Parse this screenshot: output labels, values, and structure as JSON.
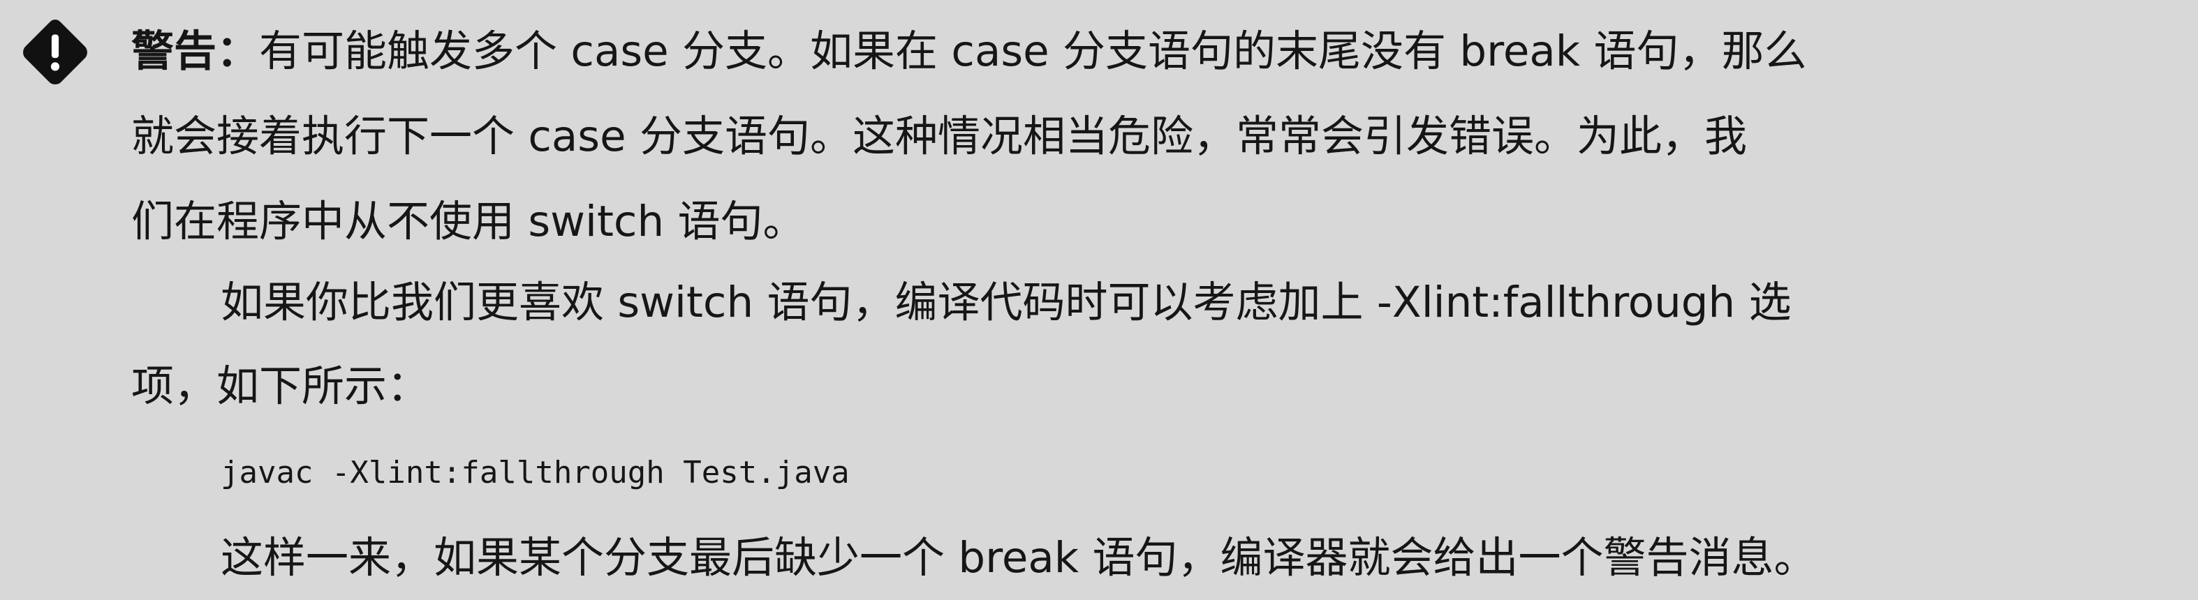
{
  "warning": {
    "icon": "warning-diamond-icon",
    "heading": "警告：",
    "line1": "有可能触发多个 case 分支。如果在 case 分支语句的末尾没有 break 语句，那么",
    "line2": "就会接着执行下一个 case 分支语句。这种情况相当危险，常常会引发错误。为此，我",
    "line3": "们在程序中从不使用 switch 语句。",
    "line4": "如果你比我们更喜欢 switch 语句，编译代码时可以考虑加上 -Xlint:fallthrough 选",
    "line5": "项，如下所示：",
    "code": "javac -Xlint:fallthrough Test.java",
    "line6": "这样一来，如果某个分支最后缺少一个 break 语句，编译器就会给出一个警告消息。"
  }
}
